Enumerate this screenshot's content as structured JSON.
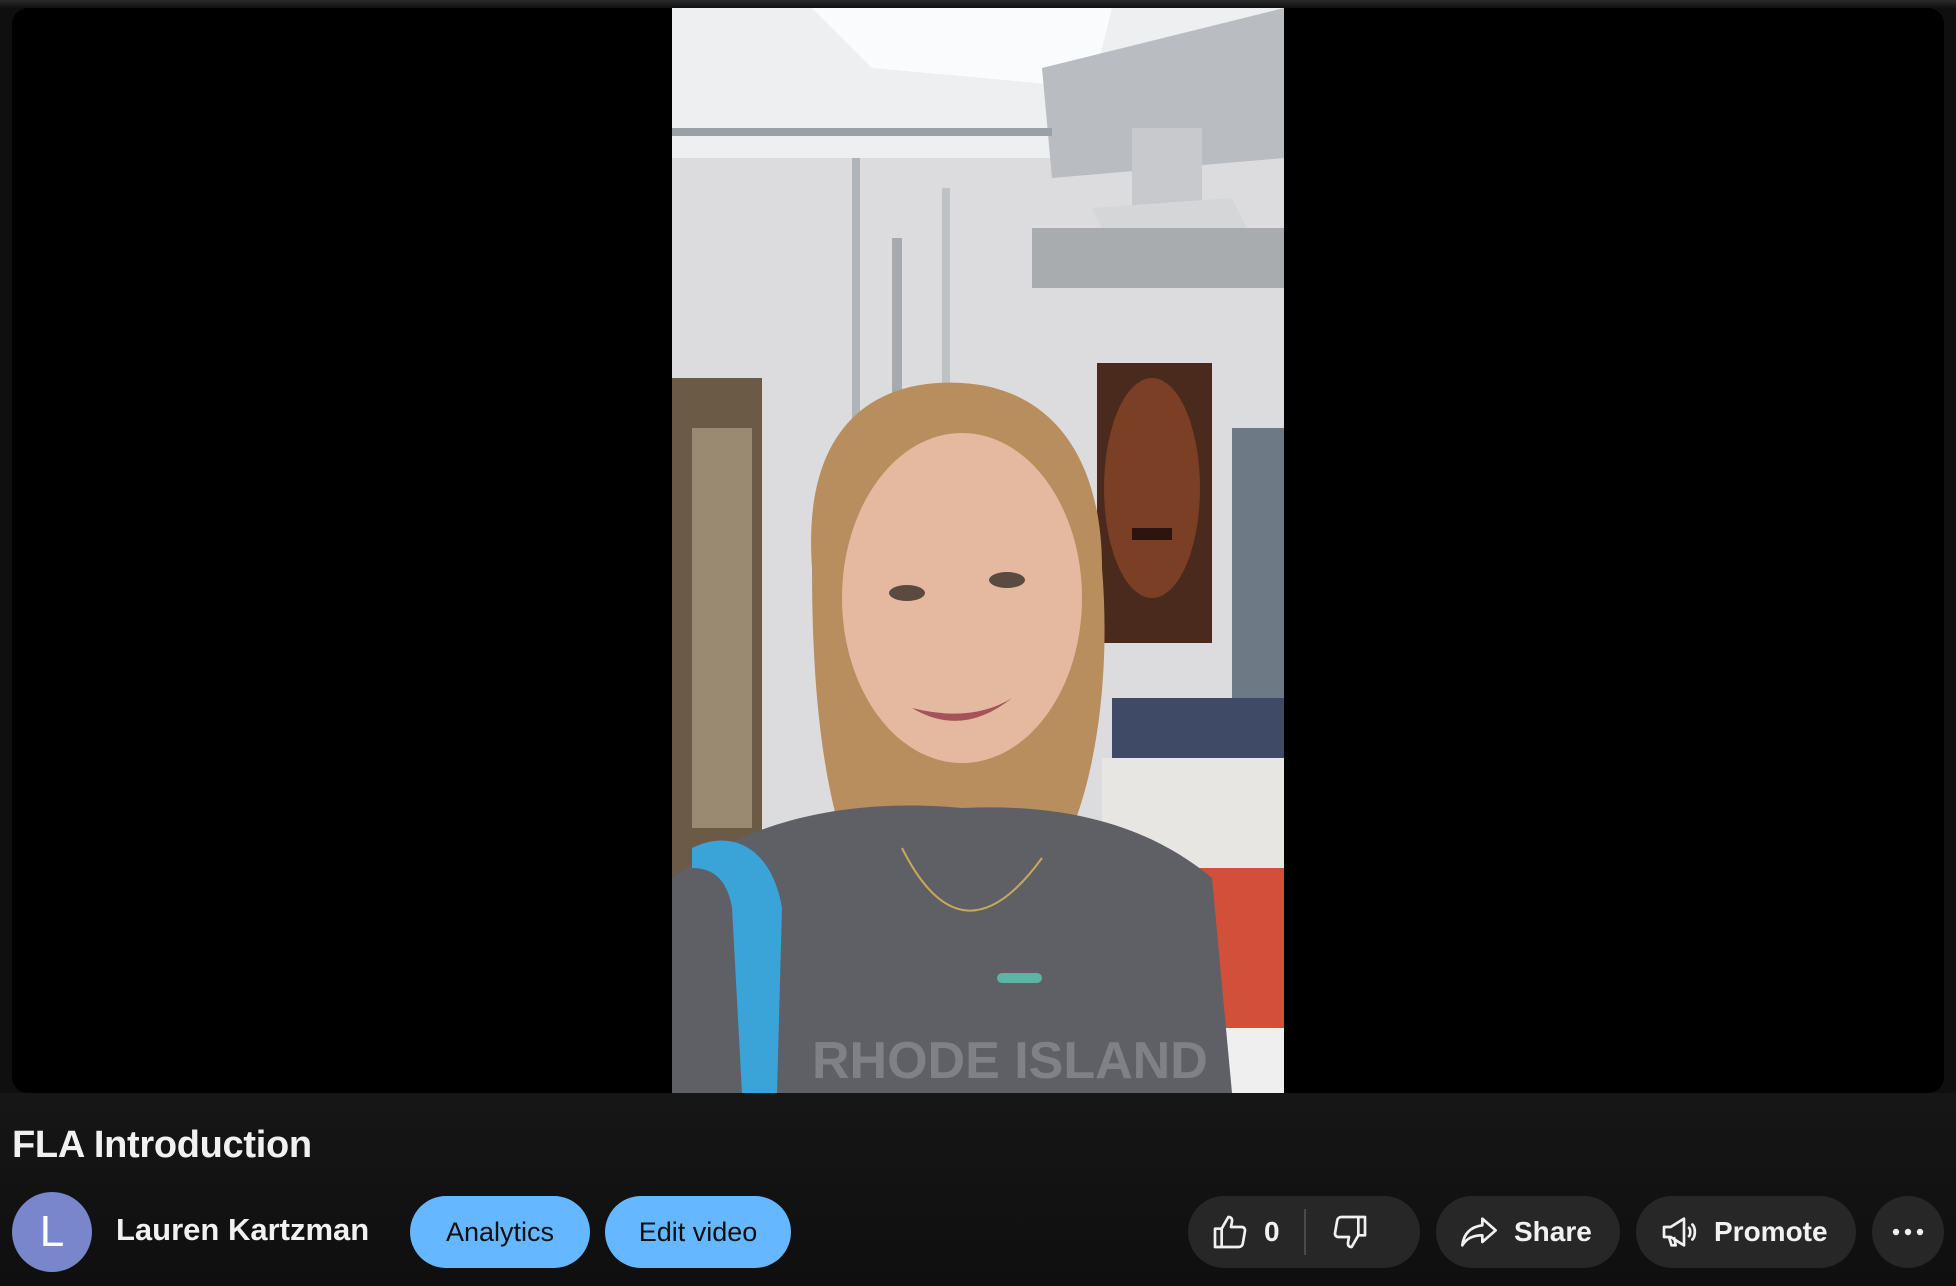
{
  "video": {
    "title": "FLA Introduction"
  },
  "channel": {
    "avatar_letter": "L",
    "name": "Lauren Kartzman"
  },
  "actions": {
    "analytics_label": "Analytics",
    "edit_label": "Edit video",
    "like_count": "0",
    "share_label": "Share",
    "promote_label": "Promote"
  },
  "icons": {
    "like": "thumbs-up-icon",
    "dislike": "thumbs-down-icon",
    "share": "share-arrow-icon",
    "promote": "megaphone-icon",
    "more": "more-horizontal-icon"
  },
  "colors": {
    "background": "#0f0f0f",
    "accent_button": "#65b8ff",
    "dark_button": "#272727",
    "avatar": "#7986cb"
  }
}
